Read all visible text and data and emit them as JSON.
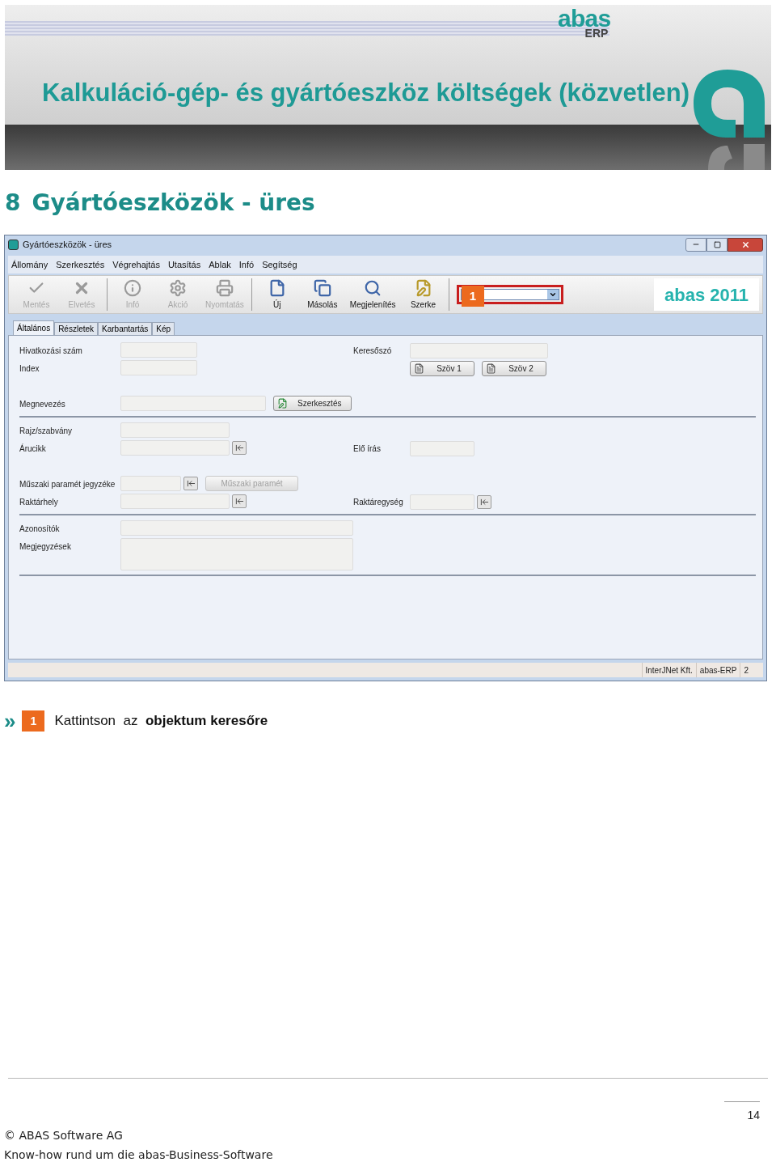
{
  "banner": {
    "title": "Kalkuláció-gép- és gyártóeszköz költségek (közvetlen)",
    "logo": "abas",
    "logo_sub": "ERP"
  },
  "heading": {
    "number": "8",
    "text": "Gyártóeszközök - üres"
  },
  "window": {
    "title": "Gyártóeszközök - üres",
    "menu": [
      "Állomány",
      "Szerkesztés",
      "Végrehajtás",
      "Utasítás",
      "Ablak",
      "Infó",
      "Segítség"
    ],
    "toolbar": [
      {
        "kind": "save",
        "label": "Mentés",
        "disabled": true
      },
      {
        "kind": "discard",
        "label": "Elvetés",
        "disabled": true
      },
      {
        "kind": "info",
        "label": "Infó",
        "disabled": true
      },
      {
        "kind": "action",
        "label": "Akció",
        "disabled": true
      },
      {
        "kind": "print",
        "label": "Nyomtatás",
        "disabled": true
      },
      {
        "kind": "new",
        "label": "Új",
        "disabled": false
      },
      {
        "kind": "copy",
        "label": "Másolás",
        "disabled": false
      },
      {
        "kind": "view",
        "label": "Megjelenítés",
        "disabled": false
      },
      {
        "kind": "edit",
        "label": "Szerke",
        "disabled": false
      }
    ],
    "callout": "1",
    "object_search": {
      "highlighted": true
    },
    "brand": "abas 2011",
    "tabs": [
      {
        "label": "Általános",
        "selected": true
      },
      {
        "label": "Részletek",
        "selected": false
      },
      {
        "label": "Karbantartás",
        "selected": false
      },
      {
        "label": "Kép",
        "selected": false
      }
    ],
    "sections": [
      {
        "rows": [
          {
            "label": "Hivatkozási szám",
            "items": [
              {
                "kind": "field"
              }
            ],
            "right_label": "Keresőszó",
            "right_items": [
              {
                "kind": "field"
              }
            ]
          },
          {
            "label": "Index",
            "items": [
              {
                "kind": "field"
              }
            ],
            "right_items": [
              {
                "kind": "text_button",
                "label": "Szöv 1",
                "disabled": false
              },
              {
                "kind": "text_button",
                "label": "Szöv 2",
                "disabled": false
              }
            ]
          },
          {
            "label": "Megnevezés",
            "items": [
              {
                "kind": "field"
              },
              {
                "kind": "edit_button",
                "label": "Szerkesztés",
                "disabled": false
              }
            ]
          }
        ]
      },
      {
        "rows": [
          {
            "label": "Rajz/szabvány",
            "items": [
              {
                "kind": "field"
              }
            ]
          },
          {
            "label": "Árucikk",
            "items": [
              {
                "kind": "field"
              },
              {
                "kind": "lookup"
              }
            ],
            "right_label": "Elő írás",
            "right_items": [
              {
                "kind": "field"
              }
            ]
          },
          {
            "label": "Műszaki paramét jegyzéke",
            "items": [
              {
                "kind": "field"
              },
              {
                "kind": "lookup"
              },
              {
                "kind": "plain_button",
                "label": "Műszaki paramét",
                "disabled": true
              }
            ]
          },
          {
            "label": "Raktárhely",
            "items": [
              {
                "kind": "field"
              },
              {
                "kind": "lookup"
              }
            ],
            "right_label": "Raktáregység",
            "right_items": [
              {
                "kind": "field"
              },
              {
                "kind": "lookup"
              }
            ]
          }
        ]
      },
      {
        "rows": [
          {
            "label": "Azonosítók",
            "items": [
              {
                "kind": "field"
              }
            ]
          },
          {
            "label": "Megjegyzések",
            "items": [
              {
                "kind": "area"
              }
            ]
          }
        ]
      }
    ],
    "status_bar": [
      "InterJNet Kft.",
      "abas-ERP",
      "2"
    ]
  },
  "instruction": {
    "marker": "»",
    "badge": "1",
    "text": "Kattintson  az  **objektum keresőre**"
  },
  "footer": {
    "page": "14",
    "copyright": "© ABAS Software AG",
    "tagline": "Know-how rund um die abas-Business-Software"
  }
}
